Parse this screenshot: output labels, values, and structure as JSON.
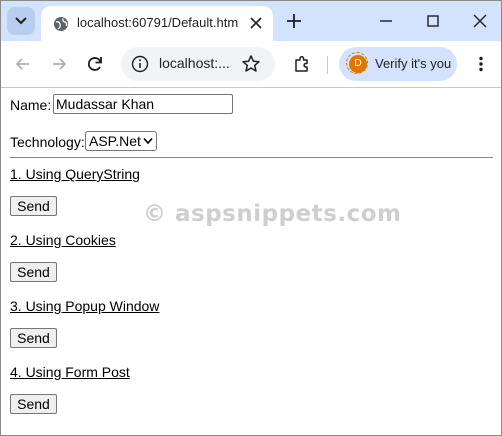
{
  "browser": {
    "tab_title": "localhost:60791/Default.htm",
    "address_text": "localhost:...",
    "verify_label": "Verify it's you",
    "avatar_letter": "D"
  },
  "form": {
    "name_label": "Name:",
    "name_value": "Mudassar Khan",
    "technology_label": "Technology:",
    "technology_selected": "ASP.Net"
  },
  "sections": [
    {
      "link": "1. Using QueryString",
      "button": "Send"
    },
    {
      "link": "2. Using Cookies",
      "button": "Send"
    },
    {
      "link": "3. Using Popup Window",
      "button": "Send"
    },
    {
      "link": "4. Using Form Post",
      "button": "Send"
    }
  ],
  "watermark": "© aspsnippets.com",
  "colors": {
    "tabstrip": "#d3e3fd",
    "verify_accent": "#e37400"
  }
}
